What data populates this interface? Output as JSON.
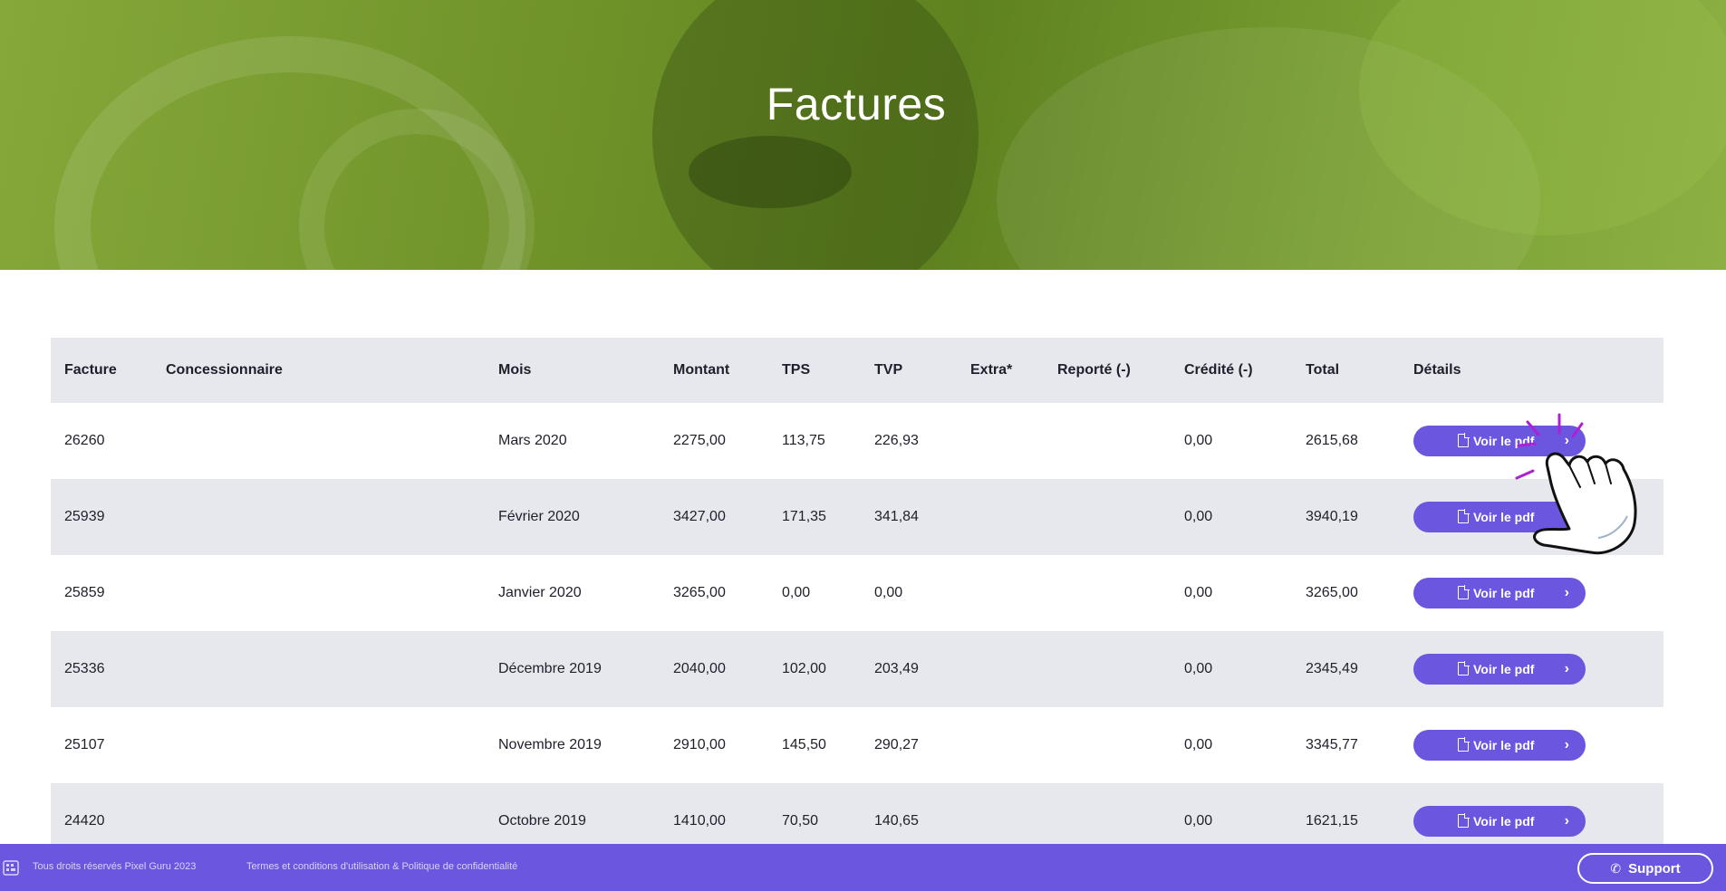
{
  "hero": {
    "title": "Factures"
  },
  "table": {
    "headers": {
      "facture": "Facture",
      "concessionnaire": "Concessionnaire",
      "mois": "Mois",
      "montant": "Montant",
      "tps": "TPS",
      "tvp": "TVP",
      "extra": "Extra*",
      "reporte": "Reporté (-)",
      "credite": "Crédité (-)",
      "total": "Total",
      "details": "Détails"
    },
    "rows": [
      {
        "facture": "26260",
        "concessionnaire": "",
        "mois": "Mars 2020",
        "montant": "2275,00",
        "tps": "113,75",
        "tvp": "226,93",
        "extra": "",
        "reporte": "",
        "credite": "0,00",
        "total": "2615,68",
        "button": "Voir le pdf"
      },
      {
        "facture": "25939",
        "concessionnaire": "",
        "mois": "Février 2020",
        "montant": "3427,00",
        "tps": "171,35",
        "tvp": "341,84",
        "extra": "",
        "reporte": "",
        "credite": "0,00",
        "total": "3940,19",
        "button": "Voir le pdf"
      },
      {
        "facture": "25859",
        "concessionnaire": "",
        "mois": "Janvier 2020",
        "montant": "3265,00",
        "tps": "0,00",
        "tvp": "0,00",
        "extra": "",
        "reporte": "",
        "credite": "0,00",
        "total": "3265,00",
        "button": "Voir le pdf"
      },
      {
        "facture": "25336",
        "concessionnaire": "",
        "mois": "Décembre 2019",
        "montant": "2040,00",
        "tps": "102,00",
        "tvp": "203,49",
        "extra": "",
        "reporte": "",
        "credite": "0,00",
        "total": "2345,49",
        "button": "Voir le pdf"
      },
      {
        "facture": "25107",
        "concessionnaire": "",
        "mois": "Novembre 2019",
        "montant": "2910,00",
        "tps": "145,50",
        "tvp": "290,27",
        "extra": "",
        "reporte": "",
        "credite": "0,00",
        "total": "3345,77",
        "button": "Voir le pdf"
      },
      {
        "facture": "24420",
        "concessionnaire": "",
        "mois": "Octobre 2019",
        "montant": "1410,00",
        "tps": "70,50",
        "tvp": "140,65",
        "extra": "",
        "reporte": "",
        "credite": "0,00",
        "total": "1621,15",
        "button": "Voir le pdf"
      }
    ]
  },
  "footer": {
    "copyright": "Tous droits réservés Pixel Guru 2023",
    "terms": "Termes et conditions d'utilisation & Politique de confidentialité",
    "support_label": "Support"
  },
  "icons": {
    "pdf": "file-pdf-icon",
    "chevron": "chevron-right-icon",
    "phone": "phone-icon",
    "logo": "pixel-guru-logo-icon",
    "cursor": "pointing-hand-cursor-icon"
  },
  "colors": {
    "accent": "#6b56e0",
    "hero_green": "#6e9128",
    "row_alt": "#e7e8ee",
    "click_burst": "#b01ed8"
  }
}
